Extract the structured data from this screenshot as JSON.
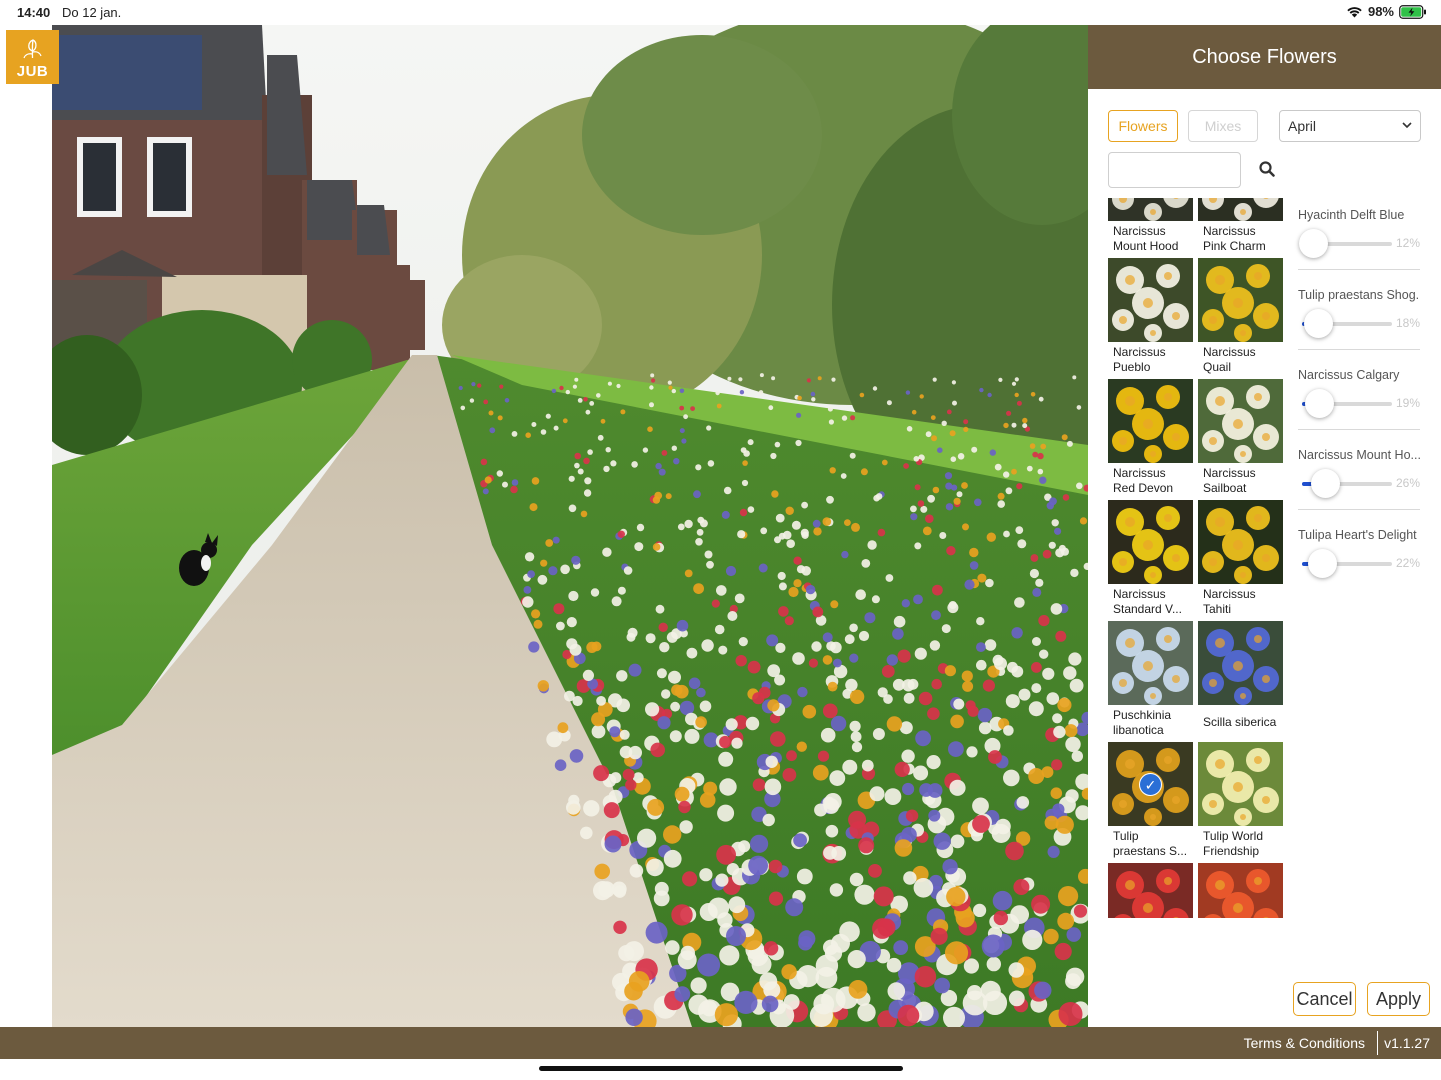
{
  "status_bar": {
    "time": "14:40",
    "date": "Do 12 jan.",
    "battery": "98%"
  },
  "logo": {
    "text": "JUB"
  },
  "panel": {
    "title": "Choose Flowers",
    "tabs": {
      "flowers": "Flowers",
      "mixes": "Mixes"
    },
    "month": "April",
    "search": {
      "value": "",
      "placeholder": ""
    }
  },
  "flowers": [
    {
      "name": "Narcissus\nMount Hood",
      "palette": [
        "#2f3327",
        "#e8e6d8"
      ]
    },
    {
      "name": "Narcissus\nPink Charm",
      "palette": [
        "#2b2f22",
        "#f1eee2"
      ]
    },
    {
      "name": "Narcissus\nPueblo",
      "palette": [
        "#3d4a2a",
        "#f5f3e6"
      ]
    },
    {
      "name": "Narcissus\nQuail",
      "palette": [
        "#3e5526",
        "#f0c21d"
      ]
    },
    {
      "name": "Narcissus\nRed Devon",
      "palette": [
        "#2a3a22",
        "#f4c20f"
      ]
    },
    {
      "name": "Narcissus\nSailboat",
      "palette": [
        "#4f6a3a",
        "#f6f3e2"
      ]
    },
    {
      "name": "Narcissus\nStandard V...",
      "palette": [
        "#2c2a1c",
        "#f4d015"
      ]
    },
    {
      "name": "Narcissus\nTahiti",
      "palette": [
        "#243019",
        "#f2c31c"
      ]
    },
    {
      "name": "Puschkinia\nlibanotica",
      "palette": [
        "#5b6a5a",
        "#cbdcef"
      ]
    },
    {
      "name": "Scilla siberica",
      "palette": [
        "#3a4d3a",
        "#5469d8"
      ]
    },
    {
      "name": "Tulip\npraestans S...",
      "palette": [
        "#3a3a22",
        "#e2a21c"
      ],
      "selected": true
    },
    {
      "name": "Tulip World\nFriendship",
      "palette": [
        "#6c8a3a",
        "#f5f0b2"
      ]
    },
    {
      "name": "",
      "palette": [
        "#7a2a25",
        "#e23a35"
      ]
    },
    {
      "name": "",
      "palette": [
        "#a13a22",
        "#ee5a2e"
      ]
    }
  ],
  "mix": [
    {
      "name": "Hyacinth Delft Blue",
      "percent": "12%",
      "value": 0.12
    },
    {
      "name": "Tulip praestans Shog...",
      "percent": "18%",
      "value": 0.18
    },
    {
      "name": "Narcissus Calgary",
      "percent": "19%",
      "value": 0.19
    },
    {
      "name": "Narcissus Mount Ho...",
      "percent": "26%",
      "value": 0.26
    },
    {
      "name": "Tulipa Heart's Delight",
      "percent": "22%",
      "value": 0.22
    }
  ],
  "buttons": {
    "cancel": "Cancel",
    "apply": "Apply"
  },
  "footer": {
    "terms": "Terms & Conditions",
    "version": "v1.1.27"
  },
  "colors": {
    "brand_brown": "#6c5a3e",
    "accent_orange": "#e7a321",
    "slider_blue": "#1f4fcf"
  }
}
